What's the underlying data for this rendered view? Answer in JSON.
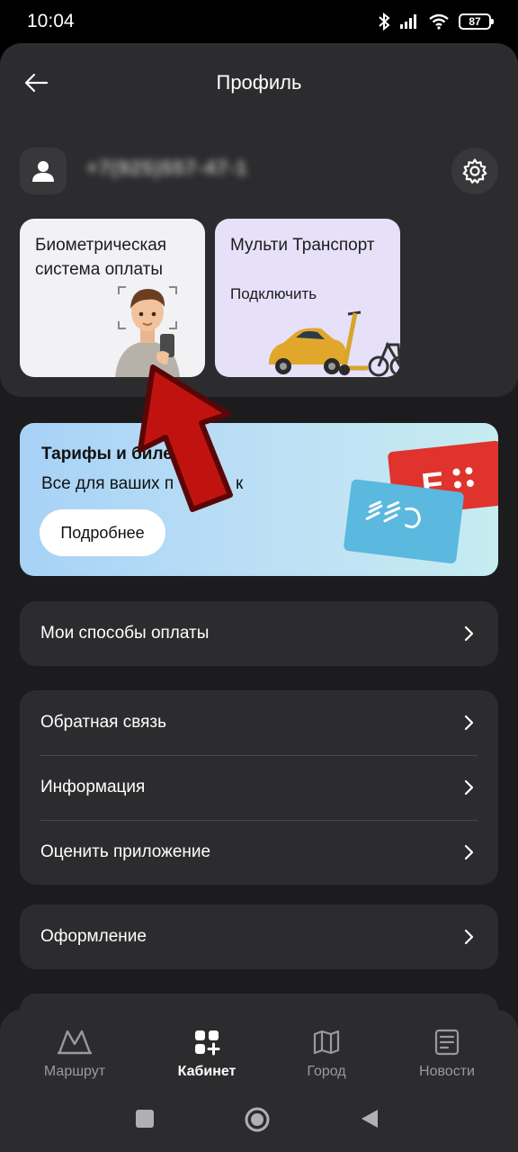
{
  "status_bar": {
    "time": "10:04",
    "battery": "87",
    "icons": [
      "bluetooth-icon",
      "signal-icon",
      "wifi-icon",
      "battery-icon"
    ]
  },
  "header": {
    "title": "Профиль",
    "back_icon": "arrow-left-icon",
    "settings_icon": "gear-icon"
  },
  "user": {
    "phone": "+7(925)557-47-1",
    "avatar_icon": "person-icon"
  },
  "promo_cards": [
    {
      "title": "Биометрическая система оплаты",
      "subtitle": ""
    },
    {
      "title": "Мульти Транспорт",
      "subtitle": "Подключить"
    }
  ],
  "tariffs": {
    "title": "Тарифы и биле",
    "subtitle": "Все для ваших п",
    "subtitle_tail": "к",
    "button": "Подробнее"
  },
  "menu": {
    "payment": [
      {
        "label": "Мои способы оплаты"
      }
    ],
    "support": [
      {
        "label": "Обратная связь"
      },
      {
        "label": "Информация"
      },
      {
        "label": "Оценить приложение"
      }
    ],
    "appearance": [
      {
        "label": "Оформление"
      }
    ]
  },
  "bottom_nav": [
    {
      "label": "Маршрут",
      "icon": "metro-icon",
      "active": false
    },
    {
      "label": "Кабинет",
      "icon": "cabinet-icon",
      "active": true
    },
    {
      "label": "Город",
      "icon": "map-icon",
      "active": false
    },
    {
      "label": "Новости",
      "icon": "news-icon",
      "active": false
    }
  ],
  "colors": {
    "background": "#1c1c1e",
    "card": "#2c2c2e",
    "accent_red": "#e0332d",
    "arrow_red": "#b01010"
  }
}
